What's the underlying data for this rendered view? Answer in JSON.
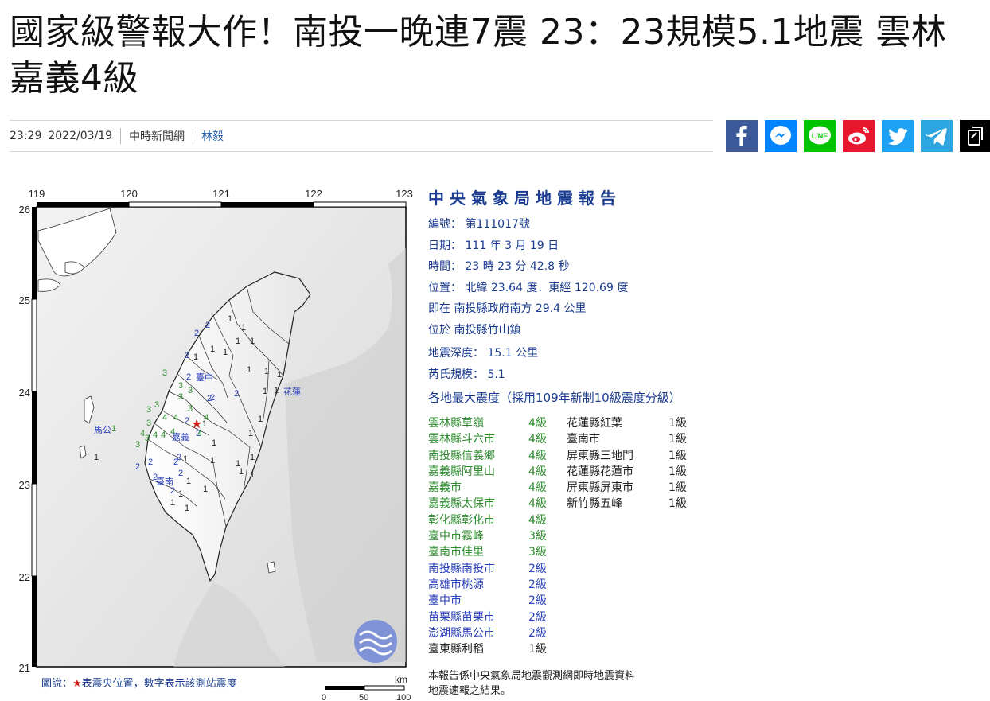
{
  "article": {
    "title": "國家級警報大作！南投一晚連7震 23：23規模5.1地震 雲林嘉義4級",
    "time": "23:29",
    "date": "2022/03/19",
    "source": "中時新聞網",
    "author": "林毅"
  },
  "share": {
    "buttons": [
      {
        "name": "facebook",
        "icon": "facebook-icon",
        "color": "#3b5998"
      },
      {
        "name": "messenger",
        "icon": "messenger-icon",
        "color": "#0084ff"
      },
      {
        "name": "line",
        "icon": "line-icon",
        "color": "#00c300"
      },
      {
        "name": "weibo",
        "icon": "weibo-icon",
        "color": "#e6162d"
      },
      {
        "name": "twitter",
        "icon": "twitter-icon",
        "color": "#1da1f2"
      },
      {
        "name": "telegram",
        "icon": "telegram-icon",
        "color": "#2ca5e0"
      },
      {
        "name": "copy-link",
        "icon": "copy-icon",
        "color": "#000000"
      }
    ],
    "line_label": "LINE"
  },
  "report": {
    "title": "中央氣象局地震報告",
    "number": "編號： 第111017號",
    "date": "日期： 111 年 3 月 19 日",
    "time": "時間： 23 時 23 分 42.8 秒",
    "position": "位置： 北緯 23.64 度．東經 120.69 度",
    "located_at": "即在 南投縣政府南方 29.4 公里",
    "located_in": "位於 南投縣竹山鎮",
    "depth": "地震深度： 15.1 公里",
    "magnitude": "芮氏規模： 5.1",
    "intensity_heading": "各地最大震度（採用109年新制10級震度分級）",
    "left_column": [
      {
        "place": "雲林縣草嶺",
        "level": "4級",
        "color": "#2e8b2e"
      },
      {
        "place": "雲林縣斗六市",
        "level": "4級",
        "color": "#2e8b2e"
      },
      {
        "place": "南投縣信義鄉",
        "level": "4級",
        "color": "#2e8b2e"
      },
      {
        "place": "嘉義縣阿里山",
        "level": "4級",
        "color": "#2e8b2e"
      },
      {
        "place": "嘉義市",
        "level": "4級",
        "color": "#2e8b2e"
      },
      {
        "place": "嘉義縣太保市",
        "level": "4級",
        "color": "#2e8b2e"
      },
      {
        "place": "彰化縣彰化市",
        "level": "4級",
        "color": "#2e8b2e"
      },
      {
        "place": "臺中市霧峰",
        "level": "3級",
        "color": "#2e8b2e"
      },
      {
        "place": "臺南市佳里",
        "level": "3級",
        "color": "#2e8b2e"
      },
      {
        "place": "南投縣南投市",
        "level": "2級",
        "color": "#2a40b8"
      },
      {
        "place": "高雄市桃源",
        "level": "2級",
        "color": "#2a40b8"
      },
      {
        "place": "臺中市",
        "level": "2級",
        "color": "#2a40b8"
      },
      {
        "place": "苗栗縣苗栗市",
        "level": "2級",
        "color": "#2a40b8"
      },
      {
        "place": "澎湖縣馬公市",
        "level": "2級",
        "color": "#2a40b8"
      },
      {
        "place": "臺東縣利稻",
        "level": "1級",
        "color": "#222222"
      }
    ],
    "right_column": [
      {
        "place": "花蓮縣紅葉",
        "level": "1級",
        "color": "#222222"
      },
      {
        "place": "臺南市",
        "level": "1級",
        "color": "#222222"
      },
      {
        "place": "屏東縣三地門",
        "level": "1級",
        "color": "#222222"
      },
      {
        "place": "花蓮縣花蓮市",
        "level": "1級",
        "color": "#222222"
      },
      {
        "place": "屏東縣屏東市",
        "level": "1級",
        "color": "#222222"
      },
      {
        "place": "新竹縣五峰",
        "level": "1級",
        "color": "#222222"
      }
    ],
    "footer_line1": "本報告係中央氣象局地震觀測網即時地震資料",
    "footer_line2": "地震速報之結果。",
    "legend_prefix": "圖說：",
    "legend_star": "★",
    "legend_text": "表震央位置，數字表示該測站震度"
  },
  "map": {
    "lon_ticks": [
      "119",
      "120",
      "121",
      "122",
      "123"
    ],
    "lat_ticks": [
      "26",
      "25",
      "24",
      "23",
      "22",
      "21"
    ],
    "labels": {
      "taichung": "臺中",
      "hualien": "花蓮",
      "chiayi": "嘉義",
      "tainan": "臺南",
      "magong": "馬公"
    },
    "scale_unit": "km",
    "scale_values": [
      "0",
      "50",
      "100"
    ]
  }
}
